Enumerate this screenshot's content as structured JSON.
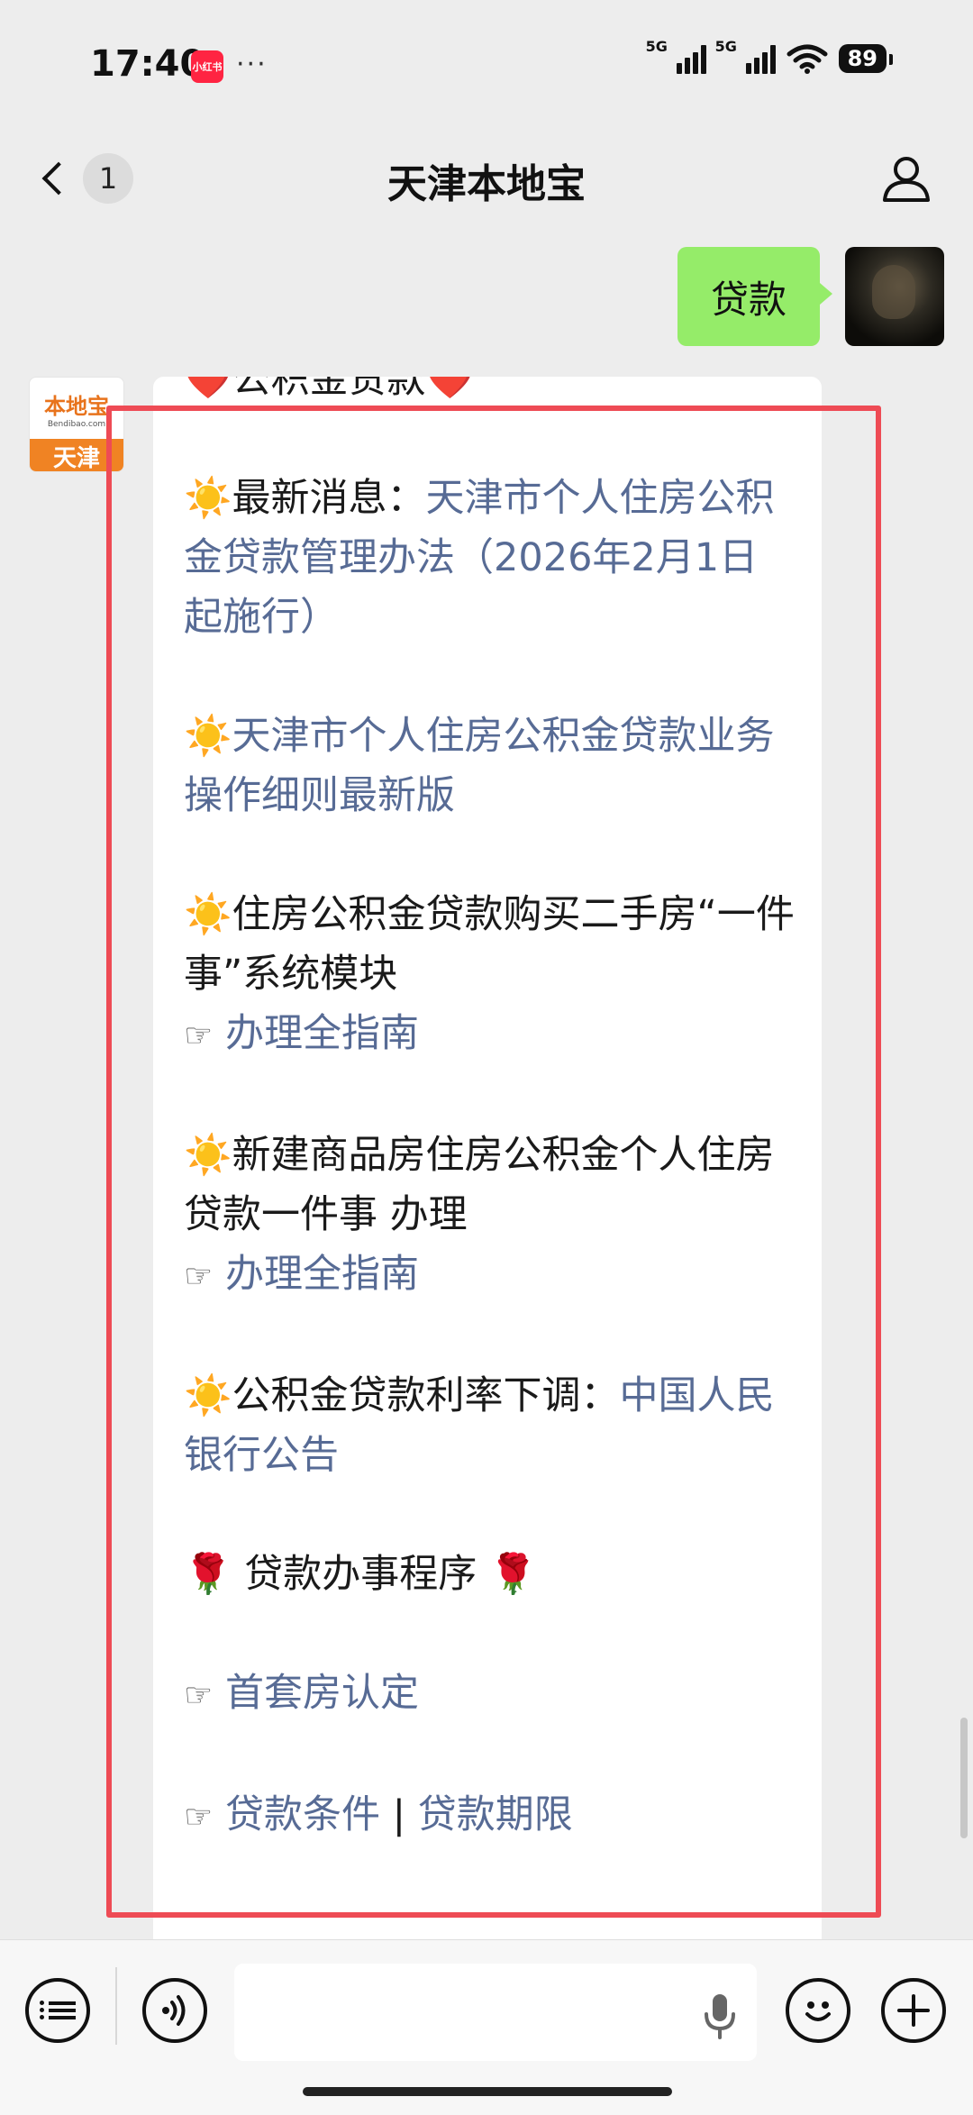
{
  "status_bar": {
    "time": "17:40",
    "app_badge": "小红书",
    "more": "···",
    "network_1": "5G",
    "network_2": "5G",
    "battery": "89"
  },
  "nav": {
    "unread_count": "1",
    "title": "天津本地宝"
  },
  "chat": {
    "sent_message": "贷款",
    "sender_logo": {
      "name": "本地宝",
      "domain": "Bendibao.com",
      "city": "天津"
    },
    "message": {
      "heading": "公积金贷款",
      "item1_prefix": "最新消息：",
      "item1_link": "天津市个人住房公积金贷款管理办法（2026年2月1日起施行）",
      "item2_link": "天津市个人住房公积金贷款业务操作细则最新版",
      "item3_text": "住房公积金贷款购买二手房“一件事”系统模块",
      "item3_link": "办理全指南",
      "item4_text": "新建商品房住房公积金个人住房贷款一件事 办理",
      "item4_link": "办理全指南",
      "item5_prefix": "公积金贷款利率下调：",
      "item5_link": "中国人民银行公告",
      "section_title": "贷款办事程序",
      "link_first_home": "首套房认定",
      "link_conditions": "贷款条件",
      "separator": "|",
      "link_term": "贷款期限"
    }
  },
  "icons": {
    "sun": "☀️",
    "heart": "❤️",
    "rose": "🌹",
    "pointing_hand": "☞"
  },
  "colors": {
    "link": "#576b95",
    "sent_bubble": "#95ec69",
    "highlight_border": "#ee4b55",
    "background": "#ededed"
  }
}
